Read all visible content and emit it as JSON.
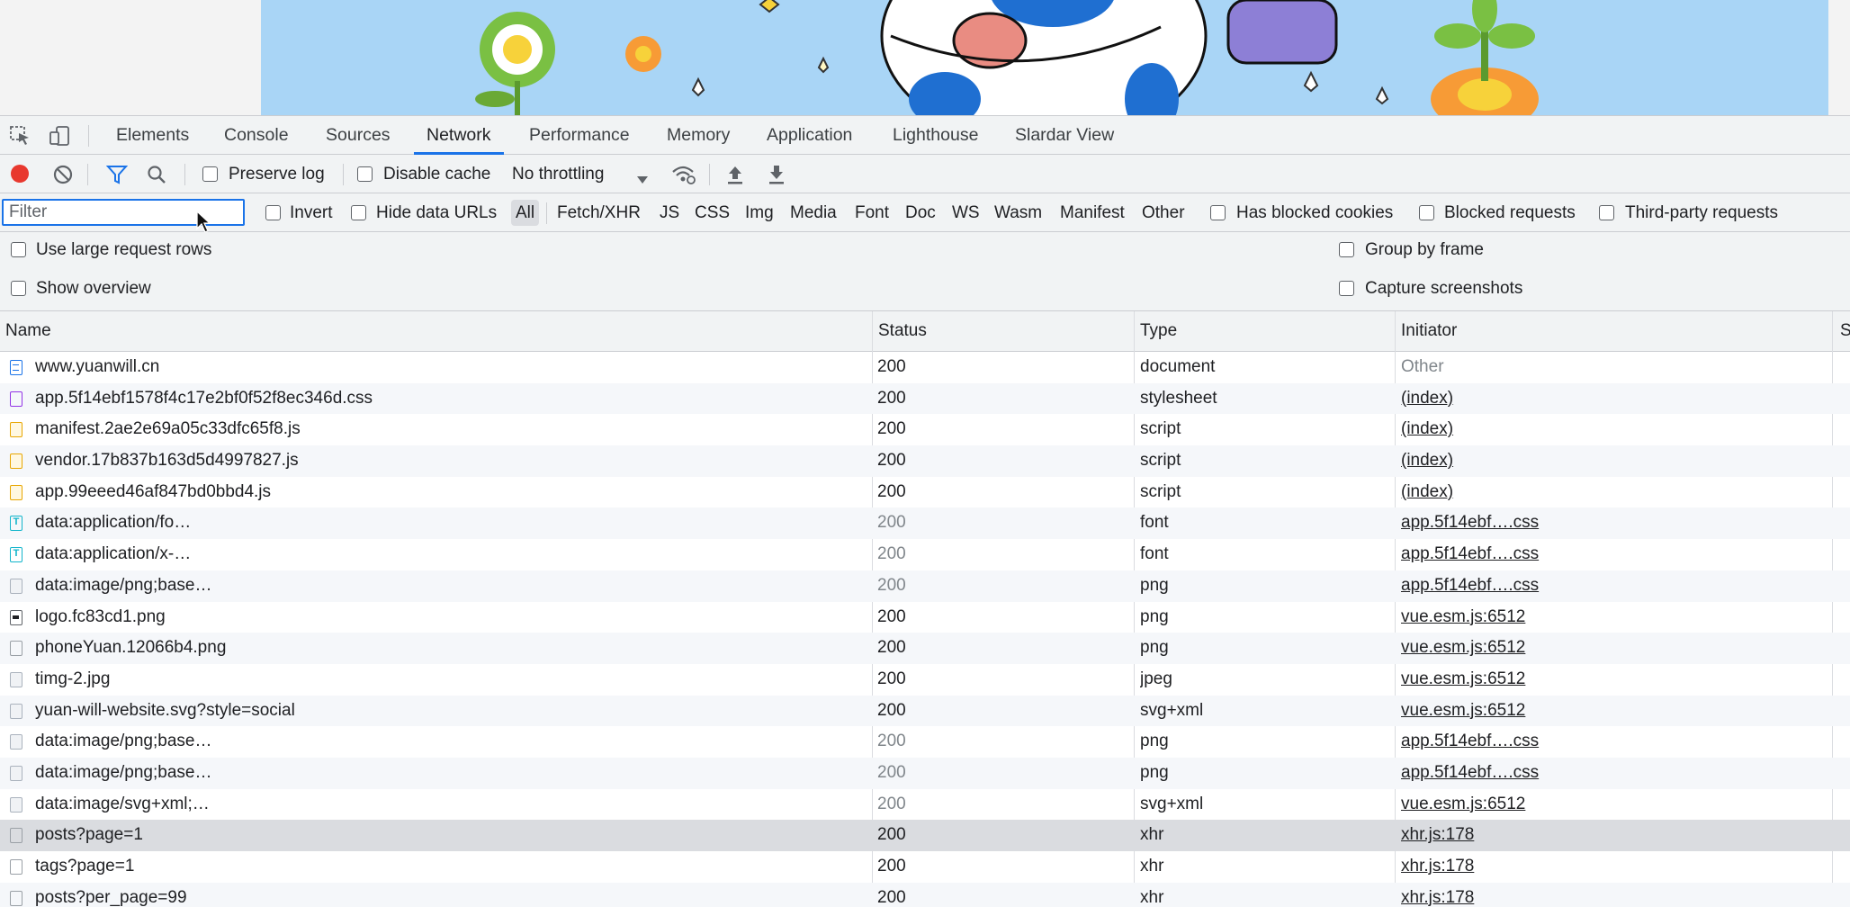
{
  "devtools": {
    "tabs": [
      {
        "label": "Elements"
      },
      {
        "label": "Console"
      },
      {
        "label": "Sources"
      },
      {
        "label": "Network"
      },
      {
        "label": "Performance"
      },
      {
        "label": "Memory"
      },
      {
        "label": "Application"
      },
      {
        "label": "Lighthouse"
      },
      {
        "label": "Slardar View"
      }
    ],
    "active_tab": "Network"
  },
  "toolbar": {
    "preserve_log": "Preserve log",
    "disable_cache": "Disable cache",
    "throttling": "No throttling",
    "recording_color": "#e8382e"
  },
  "filterbar": {
    "placeholder": "Filter",
    "invert": "Invert",
    "hide_data_urls": "Hide data URLs",
    "types": [
      "All",
      "Fetch/XHR",
      "JS",
      "CSS",
      "Img",
      "Media",
      "Font",
      "Doc",
      "WS",
      "Wasm",
      "Manifest",
      "Other"
    ],
    "selected_type": "All",
    "has_blocked_cookies": "Has blocked cookies",
    "blocked_requests": "Blocked requests",
    "third_party": "Third-party requests"
  },
  "settings": {
    "large_rows": "Use large request rows",
    "show_overview": "Show overview",
    "group_by_frame": "Group by frame",
    "capture_screenshots": "Capture screenshots"
  },
  "table": {
    "columns": [
      "Name",
      "Status",
      "Type",
      "Initiator",
      "S"
    ],
    "rows": [
      {
        "icon": "doc",
        "name": "www.yuanwill.cn",
        "status": "200",
        "type": "document",
        "initiator": "Other",
        "link": false,
        "dim": false
      },
      {
        "icon": "css",
        "name": "app.5f14ebf1578f4c17e2bf0f52f8ec346d.css",
        "status": "200",
        "type": "stylesheet",
        "initiator": "(index)",
        "link": true,
        "dim": false
      },
      {
        "icon": "script",
        "name": "manifest.2ae2e69a05c33dfc65f8.js",
        "status": "200",
        "type": "script",
        "initiator": "(index)",
        "link": true,
        "dim": false
      },
      {
        "icon": "script",
        "name": "vendor.17b837b163d5d4997827.js",
        "status": "200",
        "type": "script",
        "initiator": "(index)",
        "link": true,
        "dim": false
      },
      {
        "icon": "script",
        "name": "app.99eeed46af847bd0bbd4.js",
        "status": "200",
        "type": "script",
        "initiator": "(index)",
        "link": true,
        "dim": false
      },
      {
        "icon": "font",
        "name": "data:application/fo…",
        "status": "200",
        "type": "font",
        "initiator": "app.5f14ebf….css",
        "link": true,
        "dim": true
      },
      {
        "icon": "font",
        "name": "data:application/x-…",
        "status": "200",
        "type": "font",
        "initiator": "app.5f14ebf….css",
        "link": true,
        "dim": true
      },
      {
        "icon": "img",
        "name": "data:image/png;base…",
        "status": "200",
        "type": "png",
        "initiator": "app.5f14ebf….css",
        "link": true,
        "dim": true
      },
      {
        "icon": "imgdark",
        "name": "logo.fc83cd1.png",
        "status": "200",
        "type": "png",
        "initiator": "vue.esm.js:6512",
        "link": true,
        "dim": false
      },
      {
        "icon": "blank",
        "name": "phoneYuan.12066b4.png",
        "status": "200",
        "type": "png",
        "initiator": "vue.esm.js:6512",
        "link": true,
        "dim": false
      },
      {
        "icon": "img",
        "name": "timg-2.jpg",
        "status": "200",
        "type": "jpeg",
        "initiator": "vue.esm.js:6512",
        "link": true,
        "dim": false
      },
      {
        "icon": "img",
        "name": "yuan-will-website.svg?style=social",
        "status": "200",
        "type": "svg+xml",
        "initiator": "vue.esm.js:6512",
        "link": true,
        "dim": false
      },
      {
        "icon": "img",
        "name": "data:image/png;base…",
        "status": "200",
        "type": "png",
        "initiator": "app.5f14ebf….css",
        "link": true,
        "dim": true
      },
      {
        "icon": "img",
        "name": "data:image/png;base…",
        "status": "200",
        "type": "png",
        "initiator": "app.5f14ebf….css",
        "link": true,
        "dim": true
      },
      {
        "icon": "img",
        "name": "data:image/svg+xml;…",
        "status": "200",
        "type": "svg+xml",
        "initiator": "vue.esm.js:6512",
        "link": true,
        "dim": true
      },
      {
        "icon": "blank",
        "name": "posts?page=1",
        "status": "200",
        "type": "xhr",
        "initiator": "xhr.js:178",
        "link": true,
        "dim": false,
        "selected": true
      },
      {
        "icon": "blank",
        "name": "tags?page=1",
        "status": "200",
        "type": "xhr",
        "initiator": "xhr.js:178",
        "link": true,
        "dim": false
      },
      {
        "icon": "blank",
        "name": "posts?per_page=99",
        "status": "200",
        "type": "xhr",
        "initiator": "xhr.js:178",
        "link": true,
        "dim": false
      }
    ]
  }
}
